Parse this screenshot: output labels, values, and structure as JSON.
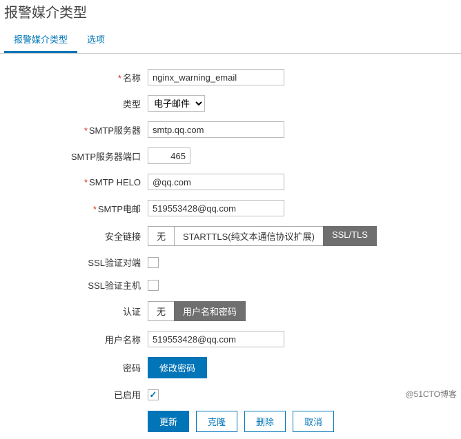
{
  "page": {
    "title": "报警媒介类型"
  },
  "tabs": [
    {
      "label": "报警媒介类型",
      "active": true
    },
    {
      "label": "选项",
      "active": false
    }
  ],
  "form": {
    "name": {
      "label": "名称",
      "required": true,
      "value": "nginx_warning_email"
    },
    "type": {
      "label": "类型",
      "required": false,
      "value": "电子邮件"
    },
    "smtp_srv": {
      "label": "SMTP服务器",
      "required": true,
      "value": "smtp.qq.com"
    },
    "smtp_port": {
      "label": "SMTP服务器端口",
      "required": false,
      "value": "465"
    },
    "smtp_helo": {
      "label": "SMTP HELO",
      "required": true,
      "value": "@qq.com"
    },
    "smtp_mail": {
      "label": "SMTP电邮",
      "required": true,
      "value": "519553428@qq.com"
    },
    "security": {
      "label": "安全链接",
      "options": [
        "无",
        "STARTTLS(纯文本通信协议扩展)",
        "SSL/TLS"
      ],
      "selected": 2
    },
    "ssl_peer": {
      "label": "SSL验证对端",
      "checked": false
    },
    "ssl_host": {
      "label": "SSL验证主机",
      "checked": false
    },
    "auth": {
      "label": "认证",
      "options": [
        "无",
        "用户名和密码"
      ],
      "selected": 1
    },
    "username": {
      "label": "用户名称",
      "value": "519553428@qq.com"
    },
    "password": {
      "label": "密码",
      "button": "修改密码"
    },
    "enabled": {
      "label": "已启用",
      "checked": true
    }
  },
  "actions": {
    "update": "更新",
    "clone": "克隆",
    "delete": "删除",
    "cancel": "取消"
  },
  "watermark": "@51CTO博客"
}
